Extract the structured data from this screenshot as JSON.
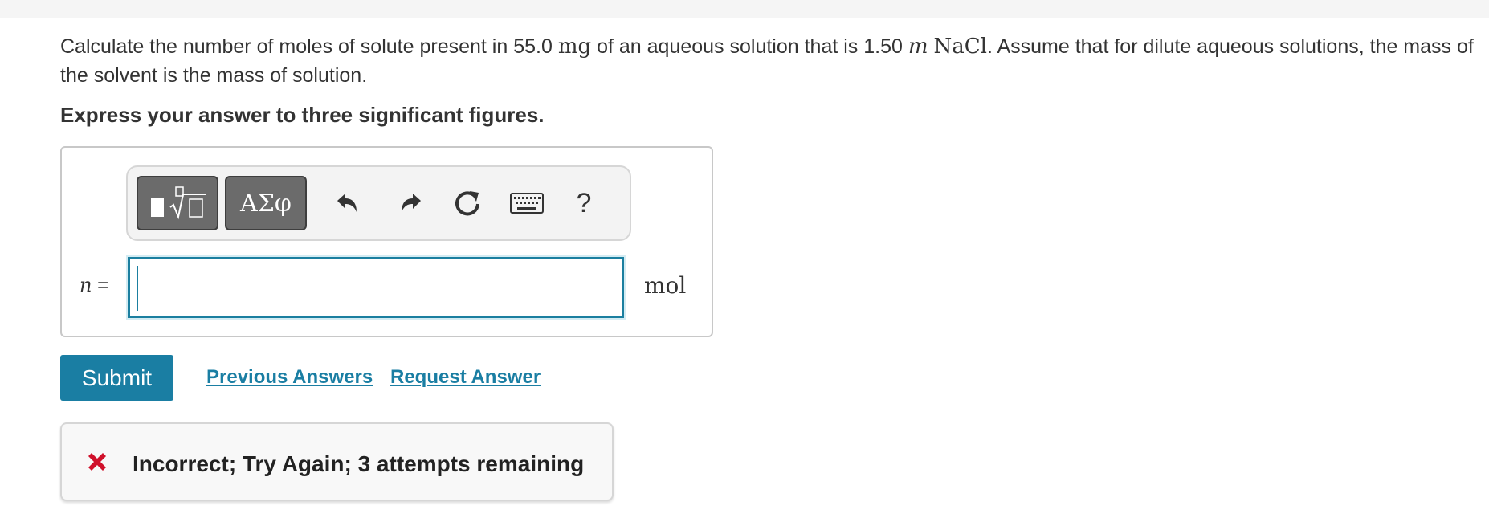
{
  "question": {
    "pre": "Calculate the number of moles of solute present in 55.0 ",
    "mass_unit": "mg",
    "mid": " of an aqueous solution that is 1.50 ",
    "molality_unit": "m",
    "compound": "NaCl",
    "post": ". Assume that for dilute aqueous solutions, the mass of the solvent is the mass of solution."
  },
  "instruction": "Express your answer to three significant figures.",
  "toolbar": {
    "symbols_label": "ΑΣφ",
    "help_label": "?"
  },
  "answer": {
    "variable": "n",
    "equals": "=",
    "value": "",
    "unit": "mol"
  },
  "actions": {
    "submit_label": "Submit",
    "previous_answers_label": "Previous Answers",
    "request_answer_label": "Request Answer"
  },
  "feedback": {
    "message": "Incorrect; Try Again; 3 attempts remaining",
    "status_color": "#d0112b"
  },
  "colors": {
    "accent": "#1a7ea3"
  }
}
